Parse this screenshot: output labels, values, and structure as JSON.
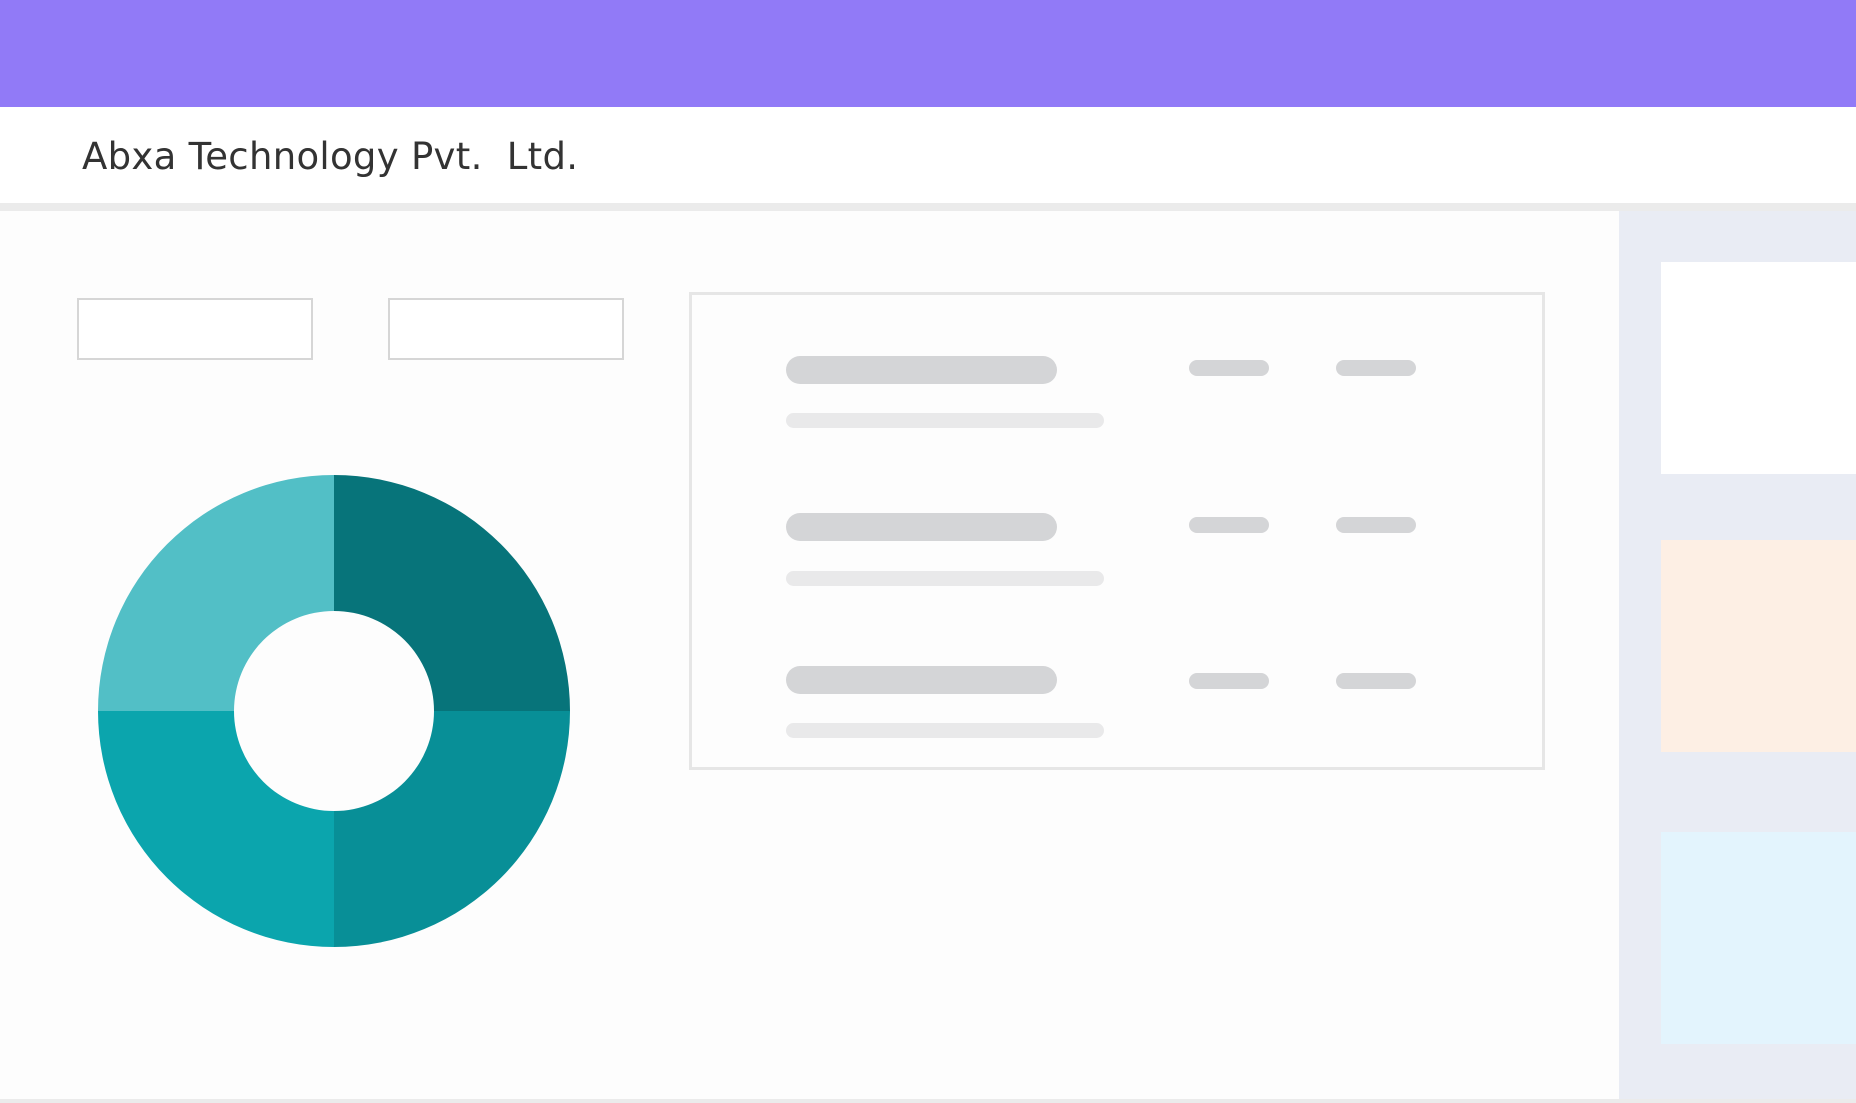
{
  "header": {
    "company_name": "Abxa Technology Pvt.  Ltd."
  },
  "colors": {
    "accent": "#917af7",
    "right_panel_bg": "#e9ecf4",
    "card_white": "#ffffff",
    "card_peach": "#fdefe4",
    "card_blue": "#e3f4fd",
    "skeleton_dark": "#d4d5d7",
    "skeleton_light": "#e9e9ea"
  },
  "chart_data": {
    "type": "pie",
    "values": [
      25,
      25,
      25,
      25
    ],
    "colors": [
      "#07747a",
      "#088f97",
      "#0ba5ad",
      "#52bfc6"
    ]
  },
  "filters": {
    "count": 2
  },
  "list_card": {
    "rows": 3
  },
  "side_cards": {
    "count": 3
  }
}
